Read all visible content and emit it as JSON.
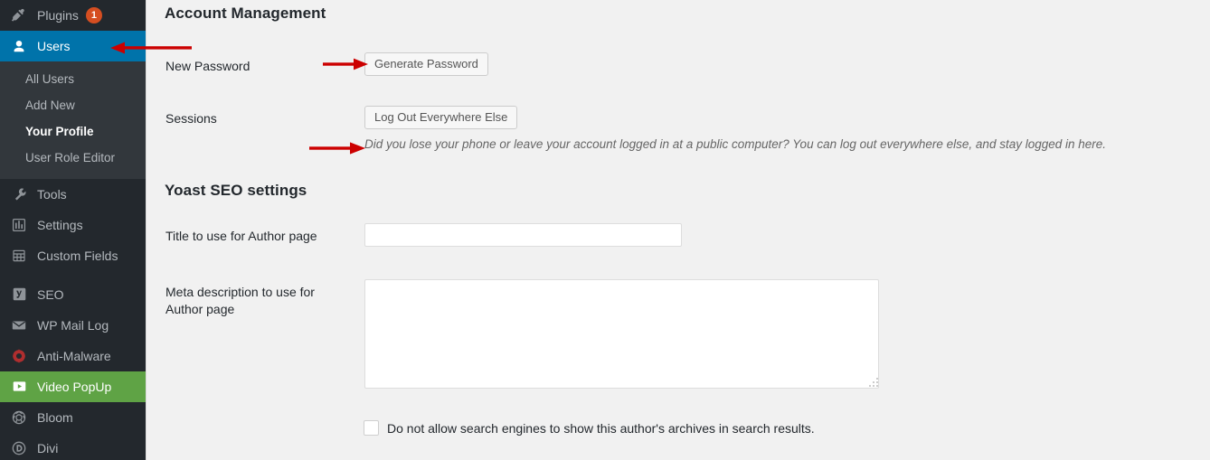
{
  "sidebar": {
    "top_items": [
      {
        "label": "Plugins",
        "icon": "plugin-icon",
        "badge": "1",
        "state": "normal"
      },
      {
        "label": "Users",
        "icon": "users-icon",
        "badge": "",
        "state": "current"
      }
    ],
    "submenu": [
      {
        "label": "All Users",
        "state": "normal"
      },
      {
        "label": "Add New",
        "state": "normal"
      },
      {
        "label": "Your Profile",
        "state": "current"
      },
      {
        "label": "User Role Editor",
        "state": "normal"
      }
    ],
    "bottom_items": [
      {
        "label": "Tools",
        "icon": "wrench-icon",
        "state": "normal"
      },
      {
        "label": "Settings",
        "icon": "sliders-icon",
        "state": "normal"
      },
      {
        "label": "Custom Fields",
        "icon": "table-icon",
        "state": "normal"
      },
      {
        "label": "SEO",
        "icon": "yoast-icon",
        "state": "normal"
      },
      {
        "label": "WP Mail Log",
        "icon": "envelope-icon",
        "state": "normal"
      },
      {
        "label": "Anti-Malware",
        "icon": "shield-virus-icon",
        "state": "normal"
      },
      {
        "label": "Video PopUp",
        "icon": "play-button-icon",
        "state": "green"
      },
      {
        "label": "Bloom",
        "icon": "bloom-flower-icon",
        "state": "normal"
      },
      {
        "label": "Divi",
        "icon": "divi-letter-icon",
        "state": "normal"
      }
    ],
    "colors": {
      "background": "#23282d",
      "submenu_background": "#32373c",
      "current_blue": "#0073aa",
      "active_green": "#5fa345",
      "badge_orange": "#d54e21",
      "text": "#b4b9be"
    }
  },
  "account_management": {
    "heading": "Account Management",
    "new_password_label": "New Password",
    "generate_password_button": "Generate Password",
    "sessions_label": "Sessions",
    "logout_everywhere_button": "Log Out Everywhere Else",
    "sessions_hint": "Did you lose your phone or leave your account logged in at a public computer? You can log out everywhere else, and stay logged in here."
  },
  "yoast": {
    "heading": "Yoast SEO settings",
    "title_label": "Title to use for Author page",
    "title_value": "",
    "title_placeholder": "",
    "meta_label": "Meta description to use for Author page",
    "meta_value": "",
    "meta_placeholder": "",
    "noindex_checkbox_label": "Do not allow search engines to show this author's archives in search results.",
    "noindex_checked": false
  },
  "annotations": {
    "arrow_color": "#cc0000",
    "arrows": [
      {
        "name": "arrow-to-users-menu",
        "direction": "left"
      },
      {
        "name": "arrow-to-generate-password",
        "direction": "right"
      },
      {
        "name": "arrow-to-sessions-hint",
        "direction": "right"
      }
    ]
  }
}
